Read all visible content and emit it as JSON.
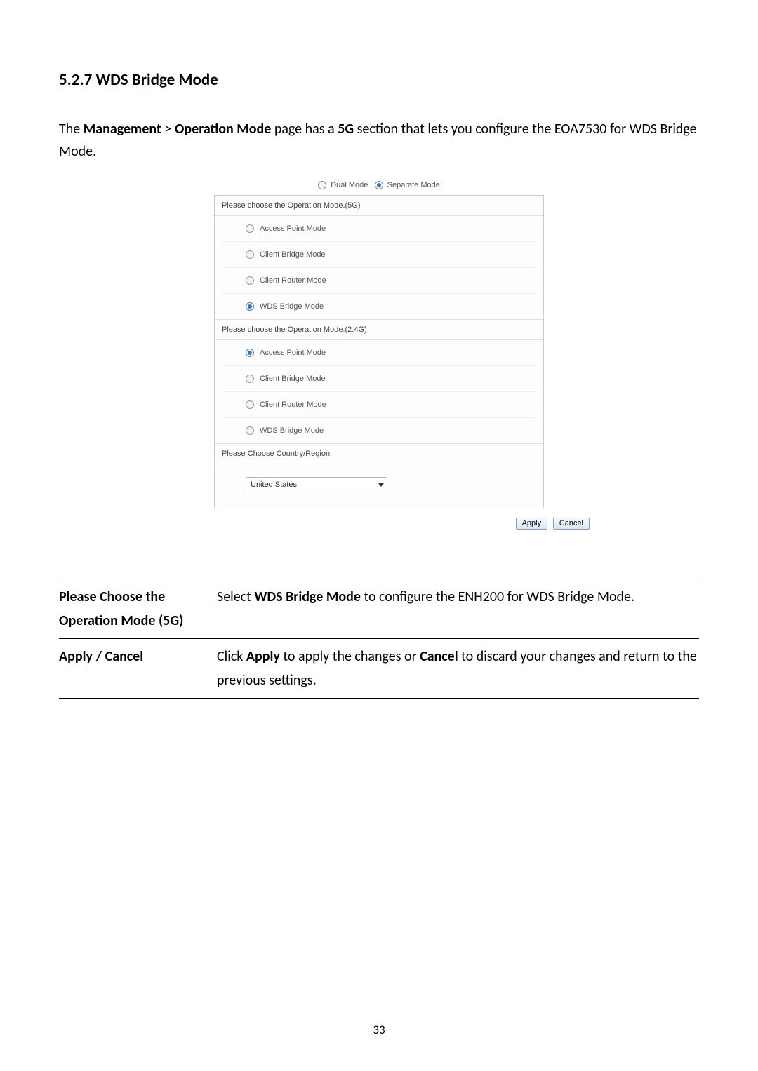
{
  "heading": "5.2.7 WDS Bridge Mode",
  "intro": {
    "pre": "The ",
    "bold1": "Management",
    "mid": " > ",
    "bold2": "Operation Mode",
    "post1": " page has a ",
    "bold3": "5G",
    "post2": " section that lets you configure the EOA7530 for WDS Bridge Mode."
  },
  "screenshot": {
    "top_mode": {
      "dual_label": "Dual Mode",
      "separate_label": "Separate Mode",
      "selected": "separate"
    },
    "group_5g": {
      "title": "Please choose the Operation Mode.(5G)",
      "options": [
        {
          "label": "Access Point Mode",
          "checked": false
        },
        {
          "label": "Client Bridge Mode",
          "checked": false
        },
        {
          "label": "Client Router Mode",
          "checked": false
        },
        {
          "label": "WDS Bridge Mode",
          "checked": true
        }
      ]
    },
    "group_24g": {
      "title": "Please choose the Operation Mode.(2.4G)",
      "options": [
        {
          "label": "Access Point Mode",
          "checked": true
        },
        {
          "label": "Client Bridge Mode",
          "checked": false
        },
        {
          "label": "Client Router Mode",
          "checked": false
        },
        {
          "label": "WDS Bridge Mode",
          "checked": false
        }
      ]
    },
    "country": {
      "title": "Please Choose Country/Region.",
      "value": "United States"
    },
    "buttons": {
      "apply": "Apply",
      "cancel": "Cancel"
    }
  },
  "definitions": [
    {
      "term_line1": "Please Choose the",
      "term_line2": "Operation Mode (5G)",
      "desc_pre": "Select ",
      "desc_bold1": "WDS Bridge Mode",
      "desc_post1": " to configure the ENH200 for WDS Bridge Mode."
    },
    {
      "term_line1": "Apply / Cancel",
      "term_line2": "",
      "desc_pre": "Click ",
      "desc_bold1": "Apply",
      "desc_mid": " to apply the changes or ",
      "desc_bold2": "Cancel",
      "desc_post1": " to discard your changes and return to the previous settings."
    }
  ],
  "page_number": "33"
}
